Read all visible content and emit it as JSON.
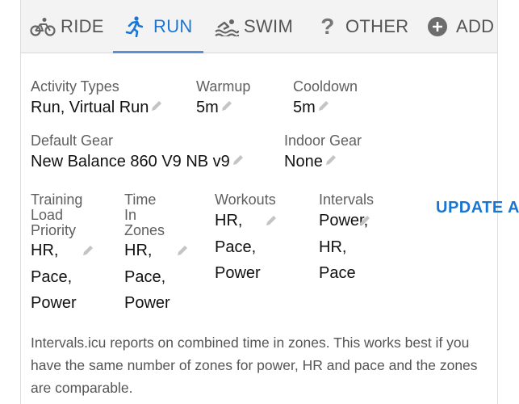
{
  "tabs": [
    {
      "label": "RIDE",
      "icon": "bike-icon"
    },
    {
      "label": "RUN",
      "icon": "run-icon"
    },
    {
      "label": "SWIM",
      "icon": "swim-icon"
    },
    {
      "label": "OTHER",
      "icon": "question-icon"
    },
    {
      "label": "ADD",
      "icon": "add-circle-icon"
    }
  ],
  "active_tab": "RUN",
  "fields": {
    "activity_types": {
      "label": "Activity Types",
      "value": "Run, Virtual Run"
    },
    "warmup": {
      "label": "Warmup",
      "value": "5m"
    },
    "cooldown": {
      "label": "Cooldown",
      "value": "5m"
    },
    "default_gear": {
      "label": "Default Gear",
      "value": "New Balance 860 V9 NB v9"
    },
    "indoor_gear": {
      "label": "Indoor Gear",
      "value": "None"
    }
  },
  "priorities": {
    "training_load": {
      "label_lines": [
        "Training",
        "Load",
        "Priority"
      ],
      "values": [
        "HR,",
        "Pace,",
        "Power"
      ]
    },
    "time_in_zones": {
      "label_lines": [
        "Time",
        "In",
        "Zones"
      ],
      "values": [
        "HR,",
        "Pace,",
        "Power"
      ]
    },
    "workouts": {
      "label_lines": [
        "Workouts"
      ],
      "values": [
        "HR,",
        "Pace,",
        "Power"
      ]
    },
    "intervals": {
      "label_lines": [
        "Intervals"
      ],
      "values": [
        "Power,",
        "HR,",
        "Pace"
      ]
    }
  },
  "update_button": "UPDATE AC",
  "note": "Intervals.icu reports on combined time in zones. This works best if you have the same number of zones for power, HR and pace and the zones are comparable.",
  "colors": {
    "accent": "#1976d2",
    "tab_bg": "#f3f3f3",
    "muted_text": "#5f5f5f"
  }
}
